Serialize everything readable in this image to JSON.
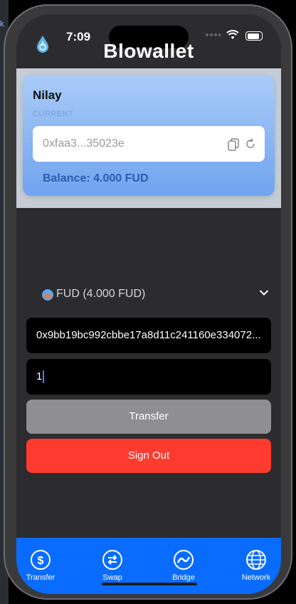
{
  "status_bar": {
    "time": "7:09"
  },
  "header": {
    "title": "Blowallet",
    "logo_icon": "drop-logo-icon"
  },
  "wallet": {
    "name": "Nilay",
    "current_label": "CURRENT",
    "address": "0xfaa3...35023e",
    "balance": "Balance: 4.000 FUD"
  },
  "token_select": {
    "selected": "FUD (4.000 FUD)"
  },
  "form": {
    "recipient": "0x9bb19bc992cbbe17a8d11c241160e334072...",
    "amount": "1",
    "transfer_label": "Transfer",
    "signout_label": "Sign Out"
  },
  "tabs": [
    {
      "label": "Transfer",
      "icon": "dollar-icon"
    },
    {
      "label": "Swap",
      "icon": "swap-icon"
    },
    {
      "label": "Bridge",
      "icon": "bridge-icon"
    },
    {
      "label": "Network",
      "icon": "globe-icon"
    }
  ],
  "colors": {
    "tabbar": "#0a6cff",
    "signout": "#ff3b30",
    "transfer_disabled": "#8e8e93",
    "card_gradient_top": "#aacbf7",
    "card_gradient_bottom": "#6fa4ef"
  }
}
